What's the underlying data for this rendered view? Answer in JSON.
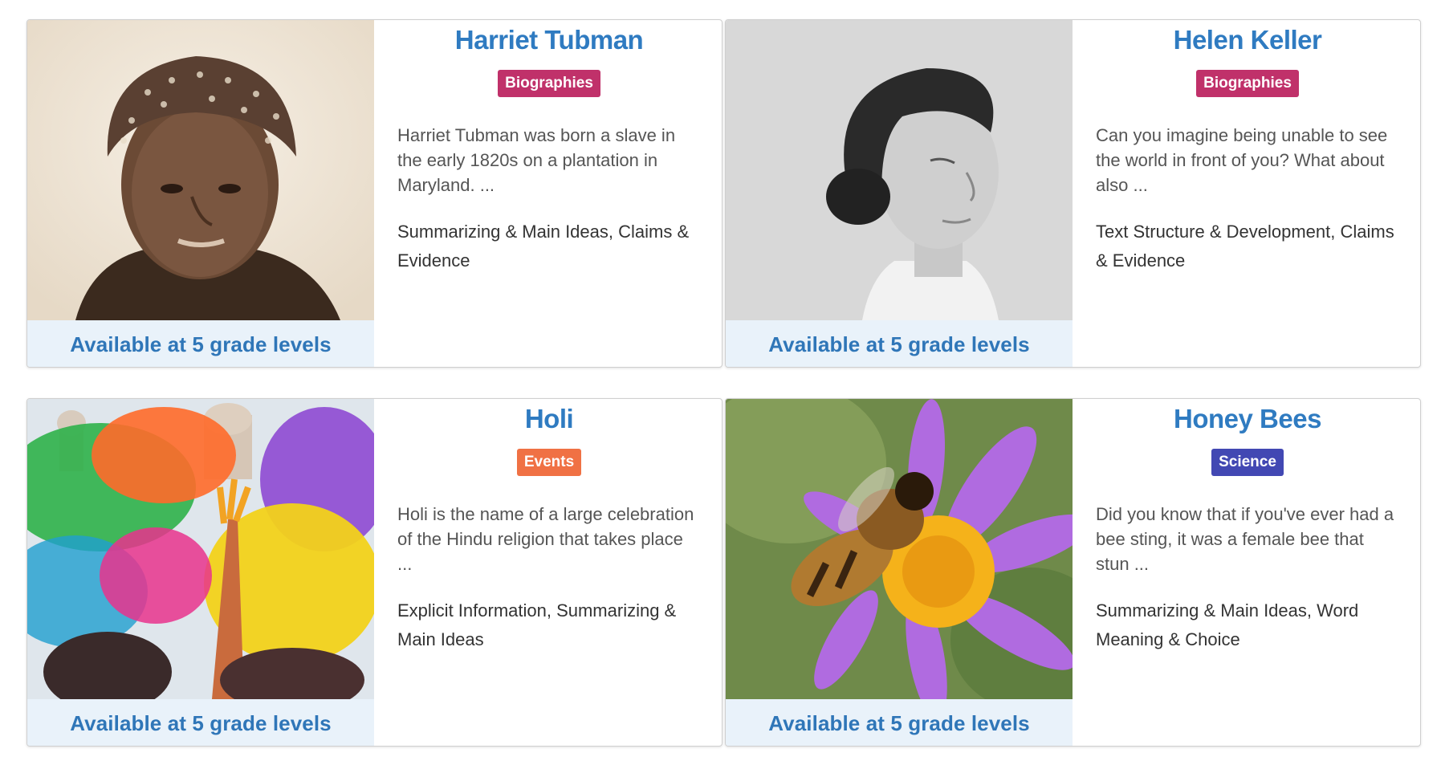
{
  "colors": {
    "title": "#2f7bc1",
    "available_text": "#2f76b8",
    "available_bg": "#e9f2fa",
    "biographies": "#c0316a",
    "events": "#f07144",
    "science": "#4248b3"
  },
  "cards": [
    {
      "title": "Harriet Tubman",
      "category": "Biographies",
      "category_color": "#c0316a",
      "description": "Harriet Tubman was born a slave in the early 1820s on a plantation in Maryland. ...",
      "skills": "Summarizing & Main Ideas, Claims & Evidence",
      "availability": "Available at 5 grade levels",
      "image": "portrait-photo-harriet-tubman"
    },
    {
      "title": "Helen Keller",
      "category": "Biographies",
      "category_color": "#c0316a",
      "description": "Can you imagine being unable to see the world in front of you? What about also ...",
      "skills": "Text Structure & Development, Claims & Evidence",
      "availability": "Available at 5 grade levels",
      "image": "portrait-photo-helen-keller"
    },
    {
      "title": "Holi",
      "category": "Events",
      "category_color": "#f07144",
      "description": "Holi is the name of a large celebration of the Hindu religion that takes place ...",
      "skills": "Explicit Information, Summarizing & Main Ideas",
      "availability": "Available at 5 grade levels",
      "image": "holi-color-powder-photo"
    },
    {
      "title": "Honey Bees",
      "category": "Science",
      "category_color": "#4248b3",
      "description": "Did you know that if you've ever had a bee sting, it was a female bee that stun ...",
      "skills": "Summarizing & Main Ideas, Word Meaning & Choice",
      "availability": "Available at 5 grade levels",
      "image": "bee-on-purple-flower-photo"
    }
  ]
}
